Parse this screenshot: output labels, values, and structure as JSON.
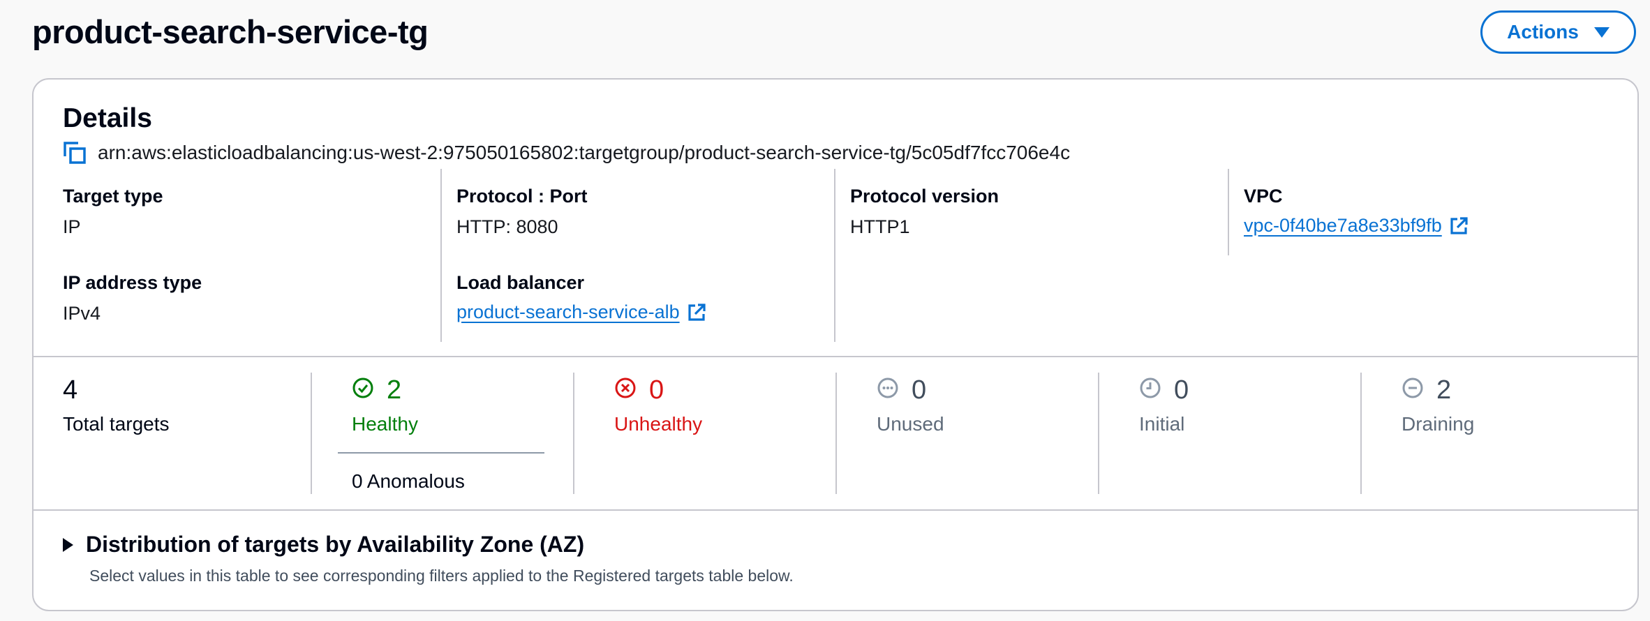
{
  "header": {
    "title": "product-search-service-tg",
    "actions_label": "Actions"
  },
  "details": {
    "title": "Details",
    "arn": "arn:aws:elasticloadbalancing:us-west-2:975050165802:targetgroup/product-search-service-tg/5c05df7fcc706e4c",
    "target_type": {
      "label": "Target type",
      "value": "IP"
    },
    "protocol_port": {
      "label": "Protocol : Port",
      "value": "HTTP: 8080"
    },
    "protocol_version": {
      "label": "Protocol version",
      "value": "HTTP1"
    },
    "vpc": {
      "label": "VPC",
      "value": "vpc-0f40be7a8e33bf9fb"
    },
    "ip_address_type": {
      "label": "IP address type",
      "value": "IPv4"
    },
    "load_balancer": {
      "label": "Load balancer",
      "value": "product-search-service-alb"
    }
  },
  "targets": {
    "total": {
      "count": "4",
      "label": "Total targets"
    },
    "healthy": {
      "count": "2",
      "label": "Healthy",
      "color": "#037f0c",
      "icon": "check-circle-icon"
    },
    "anomalous": "0 Anomalous",
    "unhealthy": {
      "count": "0",
      "label": "Unhealthy",
      "color": "#d91515",
      "icon": "x-circle-icon"
    },
    "unused": {
      "count": "0",
      "label": "Unused",
      "icon": "ellipsis-circle-icon"
    },
    "initial": {
      "count": "0",
      "label": "Initial",
      "icon": "clock-icon"
    },
    "draining": {
      "count": "2",
      "label": "Draining",
      "icon": "minus-circle-icon"
    }
  },
  "distribution": {
    "title": "Distribution of targets by Availability Zone (AZ)",
    "description": "Select values in this table to see corresponding filters applied to the Registered targets table below."
  },
  "colors": {
    "link": "#0972d3",
    "healthy": "#037f0c",
    "unhealthy": "#d91515",
    "border": "#c6c6cd"
  }
}
